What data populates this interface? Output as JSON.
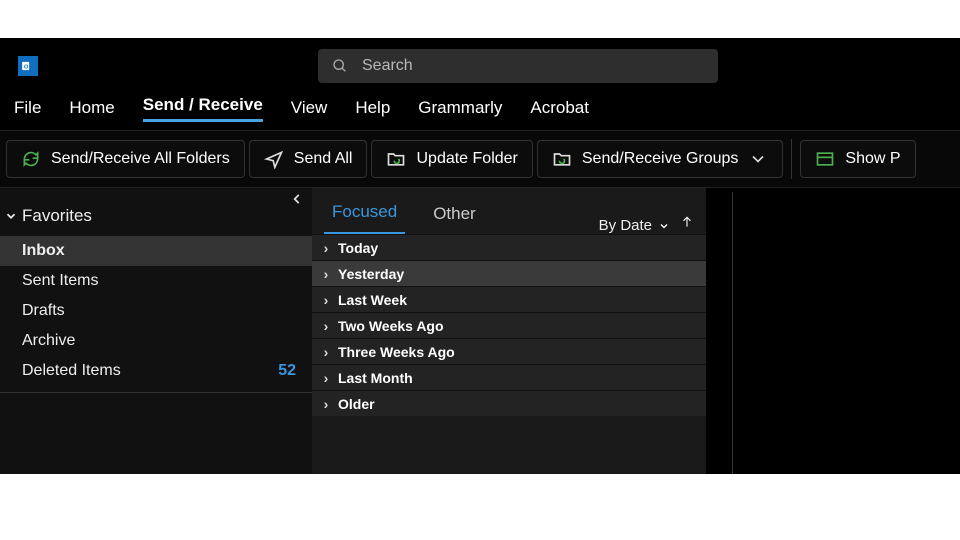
{
  "search": {
    "placeholder": "Search"
  },
  "menu": {
    "items": [
      {
        "label": "File"
      },
      {
        "label": "Home"
      },
      {
        "label": "Send / Receive"
      },
      {
        "label": "View"
      },
      {
        "label": "Help"
      },
      {
        "label": "Grammarly"
      },
      {
        "label": "Acrobat"
      }
    ],
    "active_index": 2
  },
  "ribbon": {
    "send_receive_all": "Send/Receive All Folders",
    "send_all": "Send All",
    "update_folder": "Update Folder",
    "send_receive_groups": "Send/Receive Groups",
    "show_progress": "Show P"
  },
  "sidebar": {
    "favorites_label": "Favorites",
    "items": [
      {
        "label": "Inbox",
        "count": ""
      },
      {
        "label": "Sent Items",
        "count": ""
      },
      {
        "label": "Drafts",
        "count": ""
      },
      {
        "label": "Archive",
        "count": ""
      },
      {
        "label": "Deleted Items",
        "count": "52"
      }
    ],
    "selected_index": 0
  },
  "maillist": {
    "tabs": {
      "focused": "Focused",
      "other": "Other",
      "active": "focused"
    },
    "sort_label": "By Date",
    "groups": [
      {
        "label": "Today"
      },
      {
        "label": "Yesterday"
      },
      {
        "label": "Last Week"
      },
      {
        "label": "Two Weeks Ago"
      },
      {
        "label": "Three Weeks Ago"
      },
      {
        "label": "Last Month"
      },
      {
        "label": "Older"
      }
    ],
    "hover_index": 1
  },
  "colors": {
    "accent": "#3a96dd"
  }
}
